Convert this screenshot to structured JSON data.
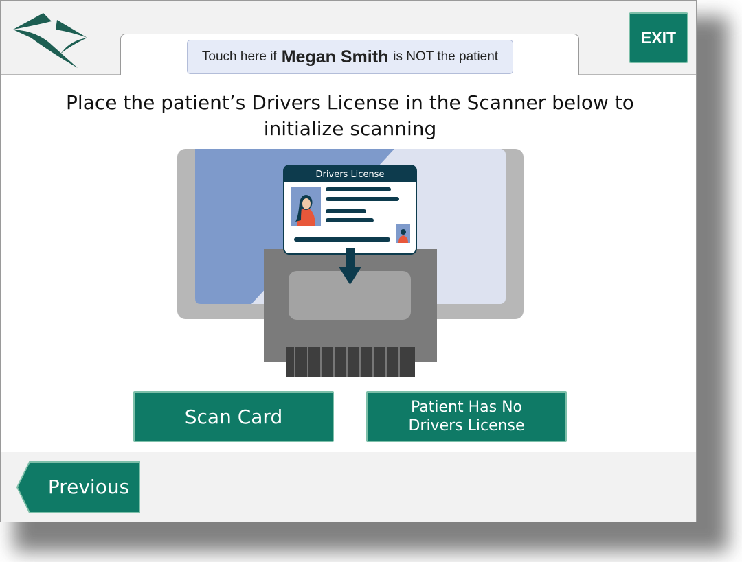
{
  "header": {
    "patient_notice": {
      "prefix": "Touch here if",
      "patient_name": "Megan Smith",
      "suffix": "is NOT the patient"
    },
    "exit_label": "EXIT"
  },
  "main": {
    "instruction": "Place the patient’s Drivers License in the Scanner below to initialize scanning",
    "license_card_title": "Drivers License",
    "scan_button_label": "Scan Card",
    "no_license_button_label": "Patient Has No Drivers License"
  },
  "footer": {
    "previous_label": "Previous"
  },
  "colors": {
    "accent": "#0f7a66",
    "card_header": "#0d3b4d",
    "notice_bg": "#e6ebf8"
  },
  "icons": {
    "logo": "brand-logo-icon",
    "arrow": "arrow-down-icon",
    "previous": "chevron-left-shape"
  }
}
